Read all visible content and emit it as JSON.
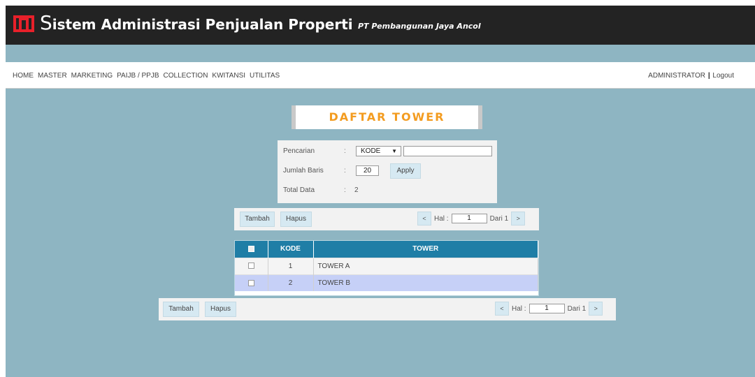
{
  "header": {
    "app_title_first": "S",
    "app_title_rest": "istem Administrasi Penjualan Properti",
    "company": "PT Pembangunan Jaya Ancol",
    "colors": {
      "bar": "#232323",
      "logo": "#e8202a"
    }
  },
  "nav": {
    "menu": [
      "HOME",
      "MASTER",
      "MARKETING",
      "PAIJB / PPJB",
      "COLLECTION",
      "KWITANSI",
      "UTILITAS"
    ],
    "user": "ADMINISTRATOR",
    "separator": "|",
    "logout": "Logout"
  },
  "page": {
    "title": "DAFTAR TOWER",
    "title_color": "#f39c20"
  },
  "search": {
    "pencarian_label": "Pencarian",
    "jumlah_label": "Jumlah Baris",
    "total_label": "Total Data",
    "colon": ":",
    "select_value": "KODE",
    "search_value": "",
    "rows_value": "20",
    "apply_label": "Apply",
    "total_value": "2"
  },
  "toolbar": {
    "add_label": "Tambah",
    "delete_label": "Hapus",
    "prev": "<",
    "next": ">",
    "hal_label": "Hal :",
    "page_value": "1",
    "of_label": "Dari 1"
  },
  "table": {
    "columns": [
      "KODE",
      "TOWER"
    ],
    "rows": [
      {
        "kode": "1",
        "tower": "TOWER A"
      },
      {
        "kode": "2",
        "tower": "TOWER B"
      }
    ]
  }
}
